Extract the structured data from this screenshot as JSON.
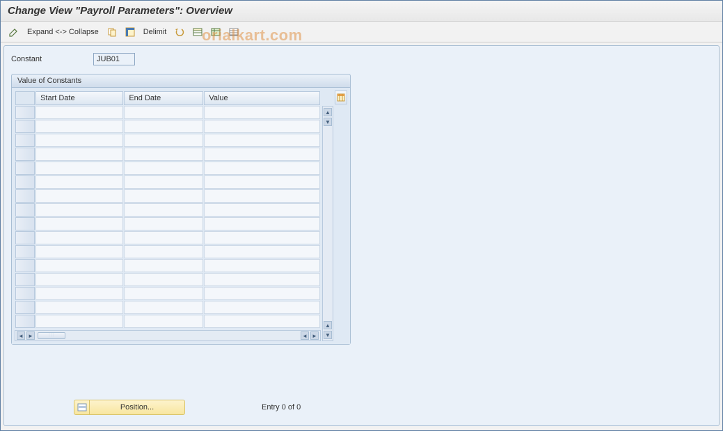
{
  "header": {
    "title": "Change View \"Payroll Parameters\": Overview"
  },
  "toolbar": {
    "expand_collapse_label": "Expand <-> Collapse",
    "delimit_label": "Delimit"
  },
  "constant": {
    "label": "Constant",
    "value": "JUB01"
  },
  "panel": {
    "title": "Value of Constants",
    "columns": [
      "Start Date",
      "End Date",
      "Value"
    ]
  },
  "footer": {
    "position_label": "Position...",
    "entry_text": "Entry 0 of 0"
  },
  "watermark": "orialkart.com",
  "colors": {
    "panel_bg": "#eaf1f9",
    "border": "#a8bed4",
    "button_yellow": "#f8e6a0"
  }
}
